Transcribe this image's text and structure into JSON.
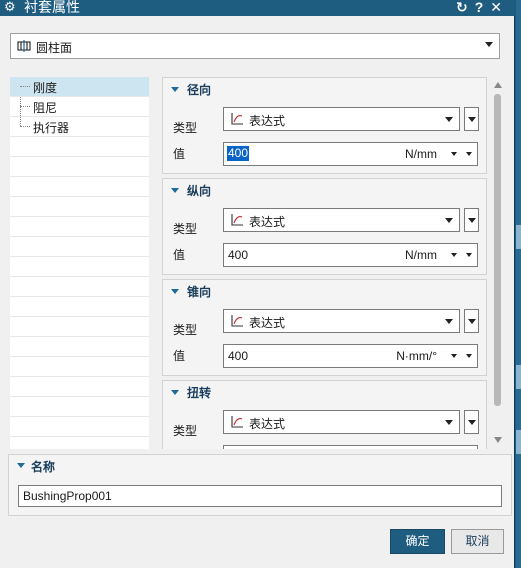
{
  "window": {
    "title": "衬套属性",
    "icons": "↻?✕"
  },
  "top_select": {
    "value": "圆柱面"
  },
  "tree": {
    "items": [
      {
        "label": "刚度"
      },
      {
        "label": "阻尼"
      },
      {
        "label": "执行器"
      }
    ]
  },
  "groups": [
    {
      "title": "径向",
      "type_label": "类型",
      "type_value": "表达式",
      "value_label": "值",
      "value": "400",
      "unit": "N/mm"
    },
    {
      "title": "纵向",
      "type_label": "类型",
      "type_value": "表达式",
      "value_label": "值",
      "value": "400",
      "unit": "N/mm"
    },
    {
      "title": "锥向",
      "type_label": "类型",
      "type_value": "表达式",
      "value_label": "值",
      "value": "400",
      "unit": "N·mm/°"
    },
    {
      "title": "扭转",
      "type_label": "类型",
      "type_value": "表达式"
    }
  ],
  "name_section": {
    "title": "名称",
    "value": "BushingProp001"
  },
  "buttons": {
    "ok": "确定",
    "cancel": "取消"
  }
}
